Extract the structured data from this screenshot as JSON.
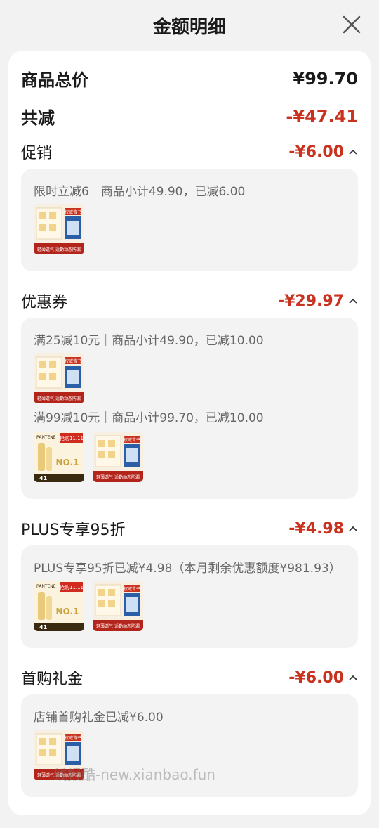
{
  "header": {
    "title": "金额明细"
  },
  "summary": {
    "total_label": "商品总价",
    "total_value": "¥99.70",
    "reduce_label": "共减",
    "reduce_value": "-¥47.41"
  },
  "sections": [
    {
      "label": "促销",
      "amount": "-¥6.00",
      "lines": [
        {
          "text": "限时立减6｜商品小计49.90，已减6.00",
          "thumbs": [
            "product-a"
          ]
        }
      ]
    },
    {
      "label": "优惠券",
      "amount": "-¥29.97",
      "lines": [
        {
          "text": "满25减10元｜商品小计49.90，已减10.00",
          "thumbs": [
            "product-a"
          ]
        },
        {
          "text": "满99减10元｜商品小计99.70，已减10.00",
          "thumbs": [
            "product-b",
            "product-a"
          ]
        }
      ]
    },
    {
      "label": "PLUS专享95折",
      "amount": "-¥4.98",
      "lines": [
        {
          "text": "PLUS专享95折已减¥4.98（本月剩余优惠额度¥981.93）",
          "thumbs": [
            "product-b",
            "product-a"
          ]
        }
      ]
    },
    {
      "label": "首购礼金",
      "amount": "-¥6.00",
      "lines": [
        {
          "text": "店铺首购礼金已减¥6.00",
          "thumbs": [
            "product-a"
          ]
        }
      ]
    }
  ],
  "thumb_text": {
    "product_a_badge": "权威背书",
    "product_a_banner": "轻薄透气 适勤动态防漏",
    "product_b_brand": "PANTENE",
    "product_b_badge": "抢购11.11",
    "product_b_rank": "NO.1",
    "product_b_price": "41"
  },
  "watermark": "线报酷-new.xianbao.fun",
  "colors": {
    "accent_red": "#c8321e",
    "card_bg": "#ffffff",
    "page_bg": "#f2f2f2",
    "box_bg": "#f3f3f3"
  }
}
